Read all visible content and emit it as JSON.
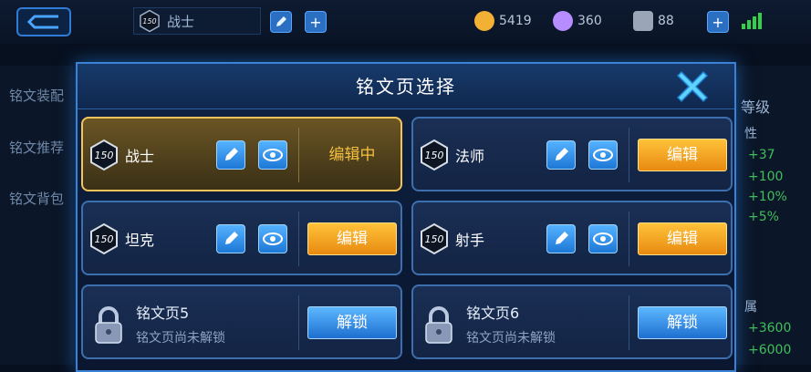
{
  "background": {
    "top_page": {
      "level": "150",
      "name": "战士"
    },
    "resources": [
      {
        "icon": "gold-coin-icon",
        "value": "5419",
        "color": "#f2b035"
      },
      {
        "icon": "gem-icon",
        "value": "360",
        "color": "#b78cff"
      },
      {
        "icon": "ticket-icon",
        "value": "88",
        "color": "#9aa6b8"
      }
    ],
    "sidebar": [
      "铭文装配",
      "铭文推荐",
      "铭文背包"
    ],
    "right_panel": {
      "head": "等级",
      "sub1": "性",
      "stats1": [
        "+37",
        "+100",
        "+10%",
        "+5%"
      ],
      "sub2": "属",
      "stats2": [
        "+3600",
        "+6000"
      ]
    }
  },
  "dialog": {
    "title": "铭文页选择",
    "pages": [
      {
        "level": "150",
        "name": "战士",
        "state": "编辑中"
      },
      {
        "level": "150",
        "name": "法师",
        "action": "编辑"
      },
      {
        "level": "150",
        "name": "坦克",
        "action": "编辑"
      },
      {
        "level": "150",
        "name": "射手",
        "action": "编辑"
      }
    ],
    "locked": [
      {
        "title": "铭文页5",
        "subtitle": "铭文页尚未解锁",
        "action": "解锁"
      },
      {
        "title": "铭文页6",
        "subtitle": "铭文页尚未解锁",
        "action": "解锁"
      }
    ]
  }
}
